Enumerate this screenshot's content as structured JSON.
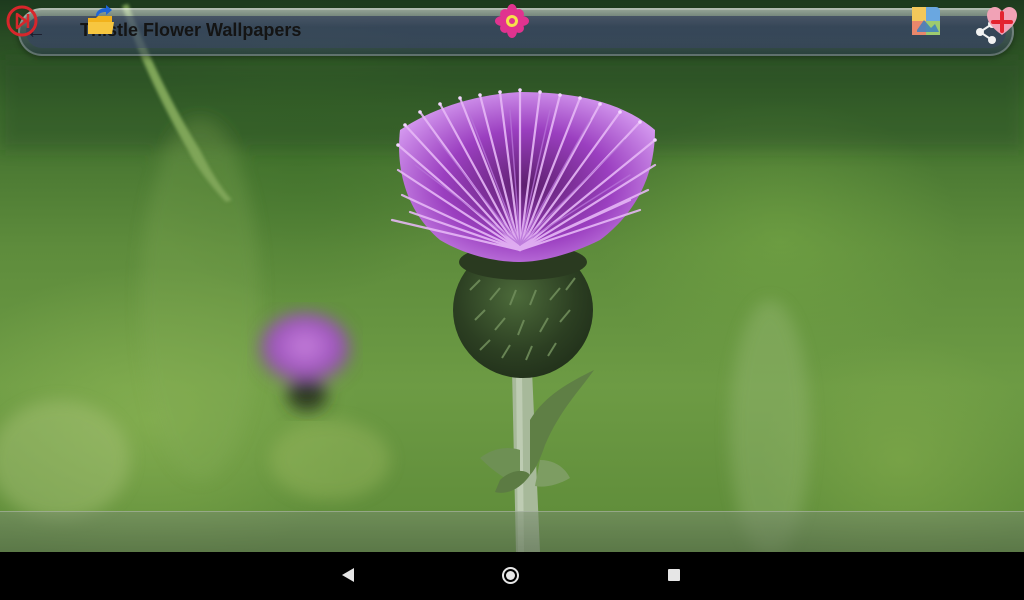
{
  "app_bar": {
    "title": "Thistle Flower Wallpapers",
    "back_icon": "arrow-left-icon",
    "share_icon": "share-icon"
  },
  "wallpaper": {
    "subject": "thistle-flower-image"
  },
  "bottom_toolbar": {
    "buttons": [
      {
        "icon": "slideshow-play-icon",
        "color": "#d8262b"
      },
      {
        "icon": "folder-export-icon",
        "color": "#f2b21c"
      },
      {
        "icon": "flower-icon",
        "color": "#e0338f"
      },
      {
        "icon": "gallery-icon",
        "color": "#6aa7e0"
      },
      {
        "icon": "heart-add-icon",
        "color": "#e83d6b"
      }
    ]
  },
  "android_nav": {
    "back_icon": "nav-back-icon",
    "home_icon": "nav-home-icon",
    "recents_icon": "nav-recents-icon"
  }
}
